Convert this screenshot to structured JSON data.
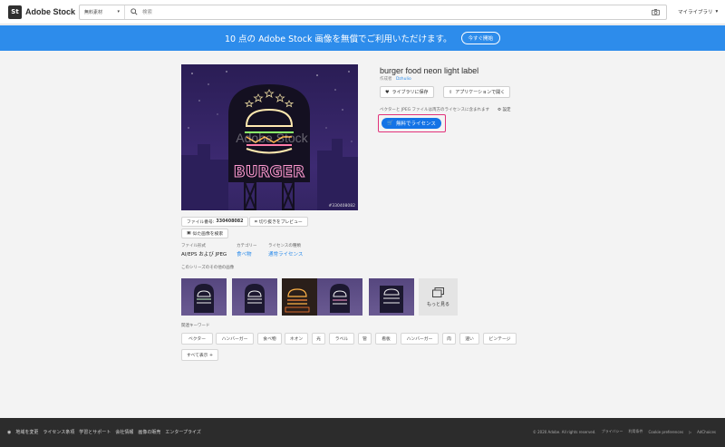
{
  "header": {
    "logo_badge": "St",
    "logo_text": "Adobe Stock",
    "scope": "無料素材",
    "search_placeholder": "検索",
    "mylib": "マイライブラリ"
  },
  "banner": {
    "text": "10 点の Adobe Stock 画像を無償でご利用いただけます。",
    "button": "今すぐ開始"
  },
  "asset": {
    "title": "burger food neon light label",
    "author_label": "作成者",
    "author_name": "Dzhulio",
    "save_btn": "ライブラリに保存",
    "open_btn": "アプリケーションで開く",
    "license_note": "ベクターと JPEG ファイルは両方のライセンスに含まれます",
    "settings_label": "設定",
    "license_btn": "無料でライセンス",
    "image_sign": "BURGER",
    "watermark": "Adobe Stock",
    "file_id_overlay": "#330408082",
    "file_no_label": "ファイル番号:",
    "file_no": "330408082",
    "preview_crop": "切り抜きをプレビュー",
    "find_similar": "似た画像を検索",
    "format_label": "ファイル形式",
    "format_value": "AI/EPS および JPEG",
    "category_label": "カテゴリー",
    "category_value": "食べ物",
    "license_type_label": "ライセンスの種類",
    "license_type_value": "通常ライセンス"
  },
  "series": {
    "label": "このシリーズのその他の画像",
    "more": "もっと見る"
  },
  "keywords": {
    "label": "関連キーワード",
    "items": [
      "ベクター",
      "ハンバーガー",
      "食べ物",
      "ネオン",
      "光",
      "ラベル",
      "管",
      "看板",
      "ハンバーガー",
      "肉",
      "速い",
      "ビンテージ"
    ],
    "show_all": "すべて表示 +"
  },
  "footer": {
    "links": [
      "地域を変更",
      "ライセンス条項",
      "学習とサポート",
      "会社情報",
      "画像の販売",
      "エンタープライズ"
    ],
    "copyright": "© 2020 Adobe. All rights reserved.",
    "privacy": "プライバシー",
    "terms": "利用条件",
    "cookie": "Cookie preferences",
    "adchoices": "AdChoices"
  },
  "colors": {
    "banner": "#2d8ceb",
    "primary": "#1473e6",
    "highlight": "#e2327a",
    "footer": "#2c2c2c"
  }
}
